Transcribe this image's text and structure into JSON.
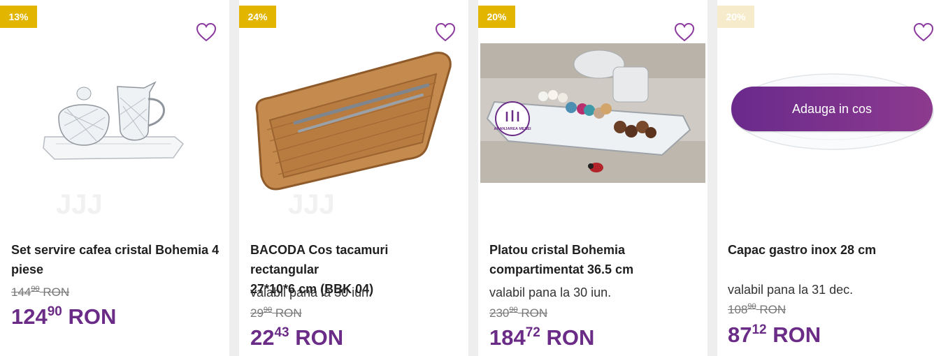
{
  "products": [
    {
      "discount": "13%",
      "title_line1": "Set servire cafea cristal Bohemia 4",
      "title_line2": "piese",
      "old_int": "144",
      "old_dec": "90",
      "old_cur": "RON",
      "new_int": "124",
      "new_dec": "90",
      "new_cur": "RON"
    },
    {
      "discount": "24%",
      "title_line1": "BACODA Cos tacamuri rectangular",
      "title_line2": "27*10*6 cm (BBK 04)",
      "valid": "valabil pana la 30 iun.",
      "old_int": "29",
      "old_dec": "90",
      "old_cur": "RON",
      "new_int": "22",
      "new_dec": "43",
      "new_cur": "RON"
    },
    {
      "discount": "20%",
      "title_line1": "Platou cristal Bohemia",
      "title_line2": "compartimentat 36.5 cm",
      "valid": "valabil pana la 30 iun.",
      "image_logo": "ARANJAREA MESEI",
      "old_int": "230",
      "old_dec": "90",
      "old_cur": "RON",
      "new_int": "184",
      "new_dec": "72",
      "new_cur": "RON"
    },
    {
      "discount": "20%",
      "title_line1": "Capac gastro inox 28 cm",
      "valid": "valabil pana la 31 dec.",
      "add_to_cart": "Adauga in cos",
      "old_int": "108",
      "old_dec": "90",
      "old_cur": "RON",
      "new_int": "87",
      "new_dec": "12",
      "new_cur": "RON"
    }
  ],
  "colors": {
    "accent": "#6a2c86",
    "badge": "#e2b600",
    "heart": "#8b3a9e"
  },
  "icons": {
    "wishlist": "heart-outline-icon"
  }
}
